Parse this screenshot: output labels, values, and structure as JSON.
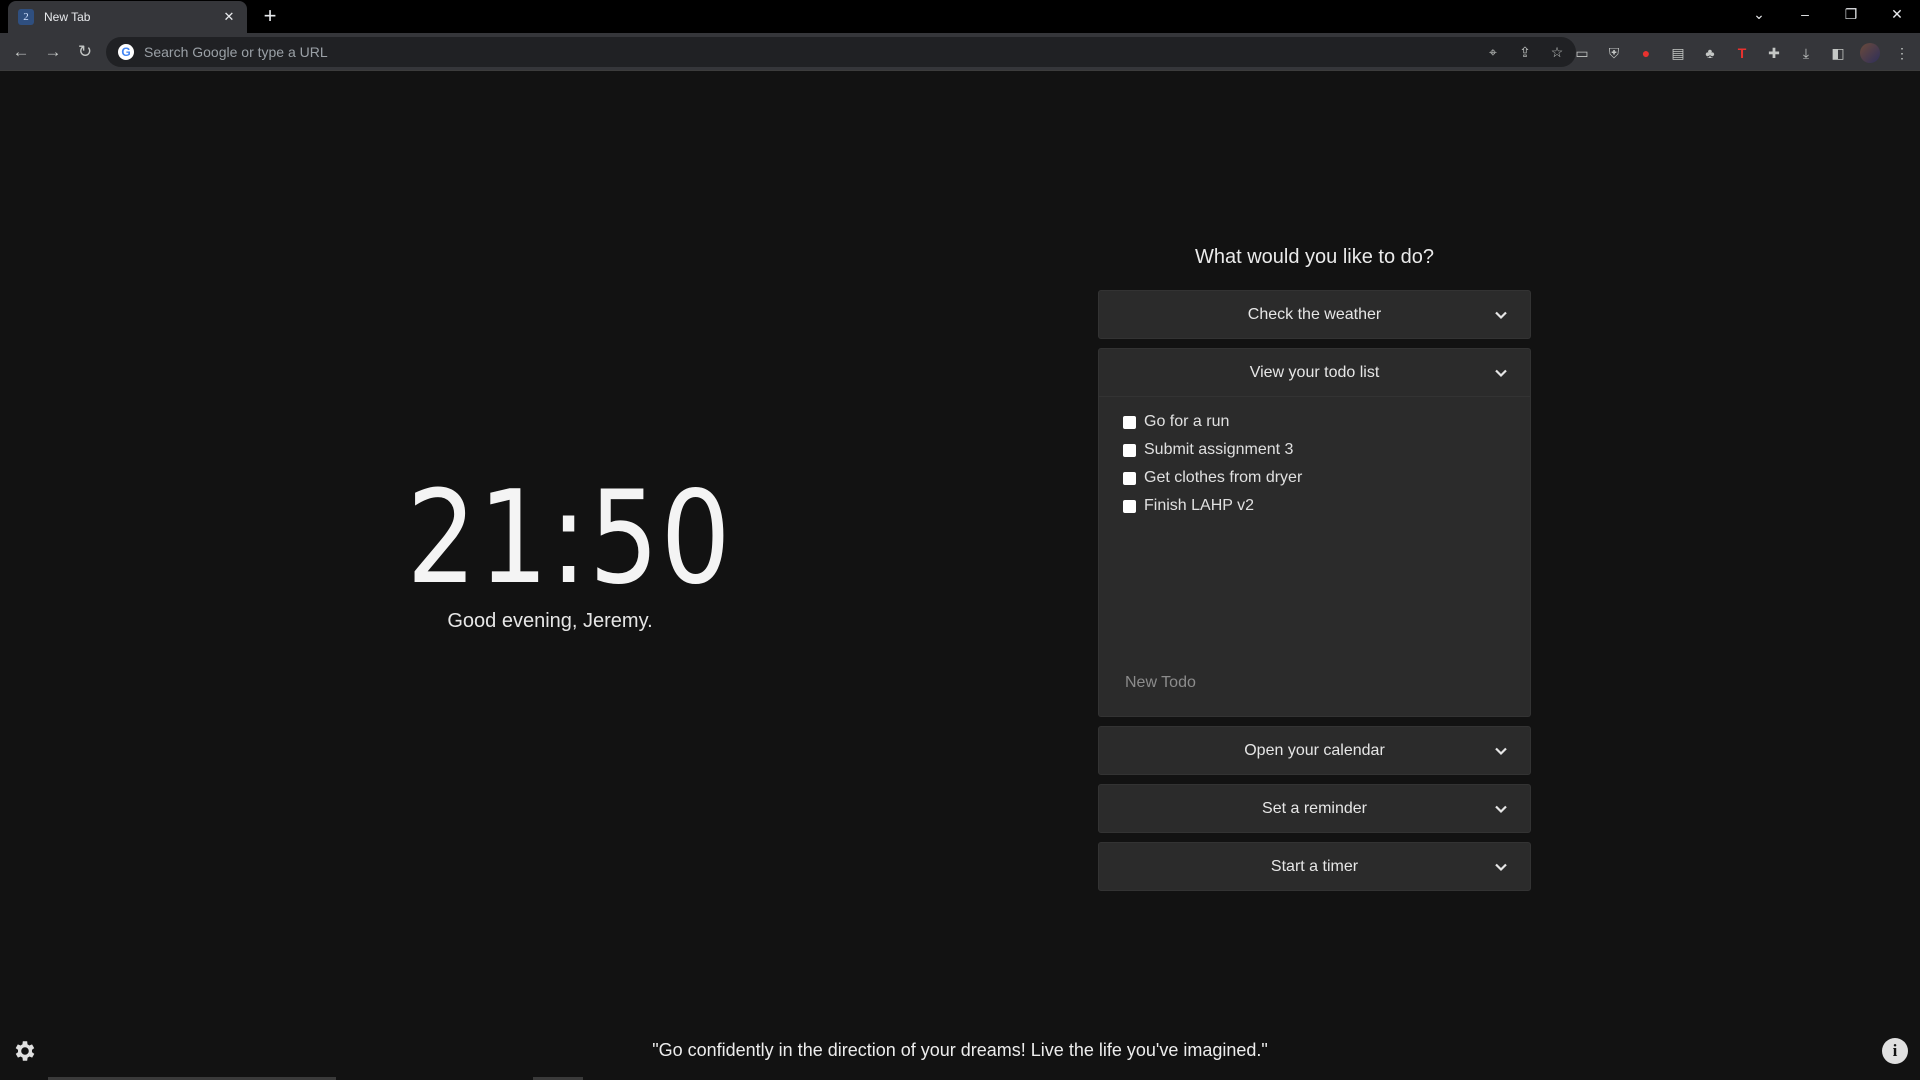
{
  "browser": {
    "tab_title": "New Tab",
    "tab_favicon": "2",
    "new_tab_symbol": "+",
    "address_placeholder": "Search Google or type a URL"
  },
  "clock": {
    "time": "21:50"
  },
  "greeting": "Good evening, Jeremy.",
  "panel": {
    "heading": "What would you like to do?",
    "weather_label": "Check the weather",
    "todo_label": "View your todo list",
    "calendar_label": "Open your calendar",
    "reminder_label": "Set a reminder",
    "timer_label": "Start a timer"
  },
  "todos": [
    {
      "text": "Go for a run",
      "done": false
    },
    {
      "text": "Submit assignment 3",
      "done": false
    },
    {
      "text": "Get clothes from dryer",
      "done": false
    },
    {
      "text": "Finish LAHP v2",
      "done": false
    }
  ],
  "new_todo_placeholder": "New Todo",
  "quote": "\"Go confidently in the direction of your dreams! Live the life you've imagined.\"",
  "icons": [
    "settings-gear-icon",
    "info-icon",
    "chevron-down-icon",
    "back-arrow-icon",
    "forward-arrow-icon",
    "reload-icon",
    "location-icon",
    "share-icon",
    "star-icon",
    "extensions-icon",
    "download-icon",
    "side-panel-icon",
    "menu-icon"
  ],
  "colors": {
    "background": "#121212",
    "panel": "#2b2b2b",
    "text": "#e6e6e6"
  }
}
